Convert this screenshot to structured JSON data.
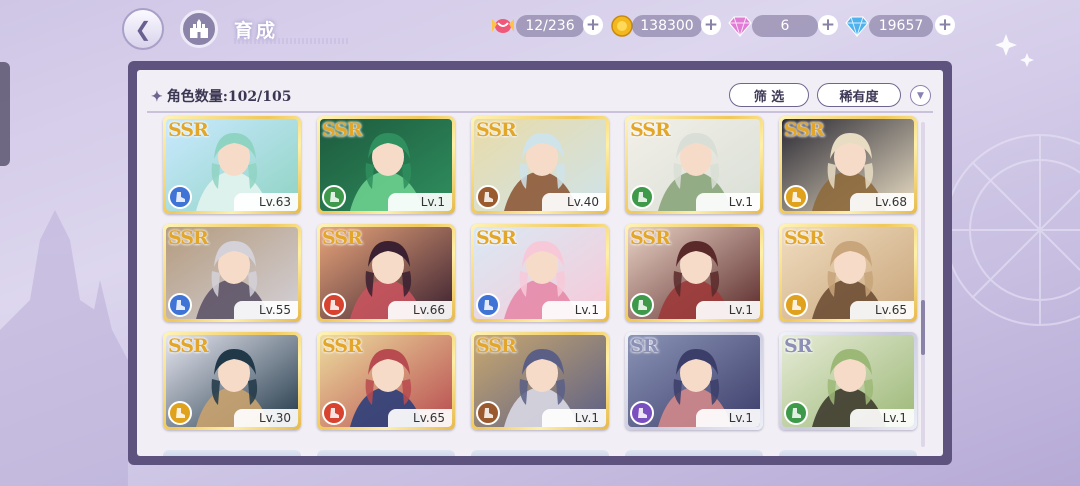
{
  "header": {
    "title": "育成",
    "back_icon": "back-arrow-icon",
    "home_icon": "castle-home-icon"
  },
  "resources": [
    {
      "name": "candy",
      "icon": "candy-icon",
      "value": "12/236"
    },
    {
      "name": "coin",
      "icon": "gold-coin-icon",
      "value": "138300"
    },
    {
      "name": "pink-gem",
      "icon": "pink-diamond-icon",
      "value": "6"
    },
    {
      "name": "blue-gem",
      "icon": "blue-diamond-icon",
      "value": "19657"
    }
  ],
  "collection": {
    "count_label": "角色数量:102/105",
    "filter_label": "筛 选",
    "sort_label": "稀有度",
    "order_icon": "chevron-down-icon"
  },
  "cards": [
    {
      "rarity": "SSR",
      "level": "Lv.63",
      "attr": "blue",
      "palette": [
        "#8fd3c3",
        "#e3f4ee",
        "#c9e9ff"
      ]
    },
    {
      "rarity": "SSR",
      "level": "Lv.1",
      "attr": "green",
      "palette": [
        "#2f8f5e",
        "#6ccf8e",
        "#1d5a3e"
      ]
    },
    {
      "rarity": "SSR",
      "level": "Lv.40",
      "attr": "brown",
      "palette": [
        "#cfe3ea",
        "#8d5a38",
        "#e9dba8"
      ]
    },
    {
      "rarity": "SSR",
      "level": "Lv.1",
      "attr": "green",
      "palette": [
        "#d9dfd6",
        "#8aa57b",
        "#f2efe8"
      ]
    },
    {
      "rarity": "SSR",
      "level": "Lv.68",
      "attr": "yellow",
      "palette": [
        "#e8dcc3",
        "#8e6a3c",
        "#2b2a34"
      ]
    },
    {
      "rarity": "SSR",
      "level": "Lv.55",
      "attr": "blue",
      "palette": [
        "#d4d1d8",
        "#5d5468",
        "#b49b7e"
      ]
    },
    {
      "rarity": "SSR",
      "level": "Lv.66",
      "attr": "red",
      "palette": [
        "#3a2030",
        "#c6535e",
        "#e7a47a"
      ]
    },
    {
      "rarity": "SSR",
      "level": "Lv.1",
      "attr": "blue",
      "palette": [
        "#f7c9d8",
        "#e58aa9",
        "#d9e9f4"
      ]
    },
    {
      "rarity": "SSR",
      "level": "Lv.1",
      "attr": "green",
      "palette": [
        "#5a2a2a",
        "#9c3a3a",
        "#e8d1c4"
      ]
    },
    {
      "rarity": "SSR",
      "level": "Lv.65",
      "attr": "yellow",
      "palette": [
        "#c8a57a",
        "#6e4f35",
        "#f0dcbf"
      ]
    },
    {
      "rarity": "SSR",
      "level": "Lv.30",
      "attr": "yellow",
      "palette": [
        "#213848",
        "#c8a26e",
        "#e6e6f0"
      ]
    },
    {
      "rarity": "SSR",
      "level": "Lv.65",
      "attr": "red",
      "palette": [
        "#b84b4f",
        "#2e3f7a",
        "#eddc9e"
      ]
    },
    {
      "rarity": "SSR",
      "level": "Lv.1",
      "attr": "brown",
      "palette": [
        "#5b5f86",
        "#d8d8e4",
        "#c9a86f"
      ]
    },
    {
      "rarity": "SR",
      "level": "Lv.1",
      "attr": "purple",
      "palette": [
        "#3c3e6a",
        "#d0888a",
        "#8a93b6"
      ]
    },
    {
      "rarity": "SR",
      "level": "Lv.1",
      "attr": "green",
      "palette": [
        "#9cb877",
        "#3f3c2f",
        "#e6ebd6"
      ]
    }
  ],
  "colors": {
    "attr_blue": "#3f74d6",
    "attr_green": "#3e9a4a",
    "attr_brown": "#9a5a2e",
    "attr_yellow": "#e0a21c",
    "attr_red": "#d8432f",
    "attr_purple": "#7a4fc0",
    "panel_frame": "#5e537e"
  }
}
